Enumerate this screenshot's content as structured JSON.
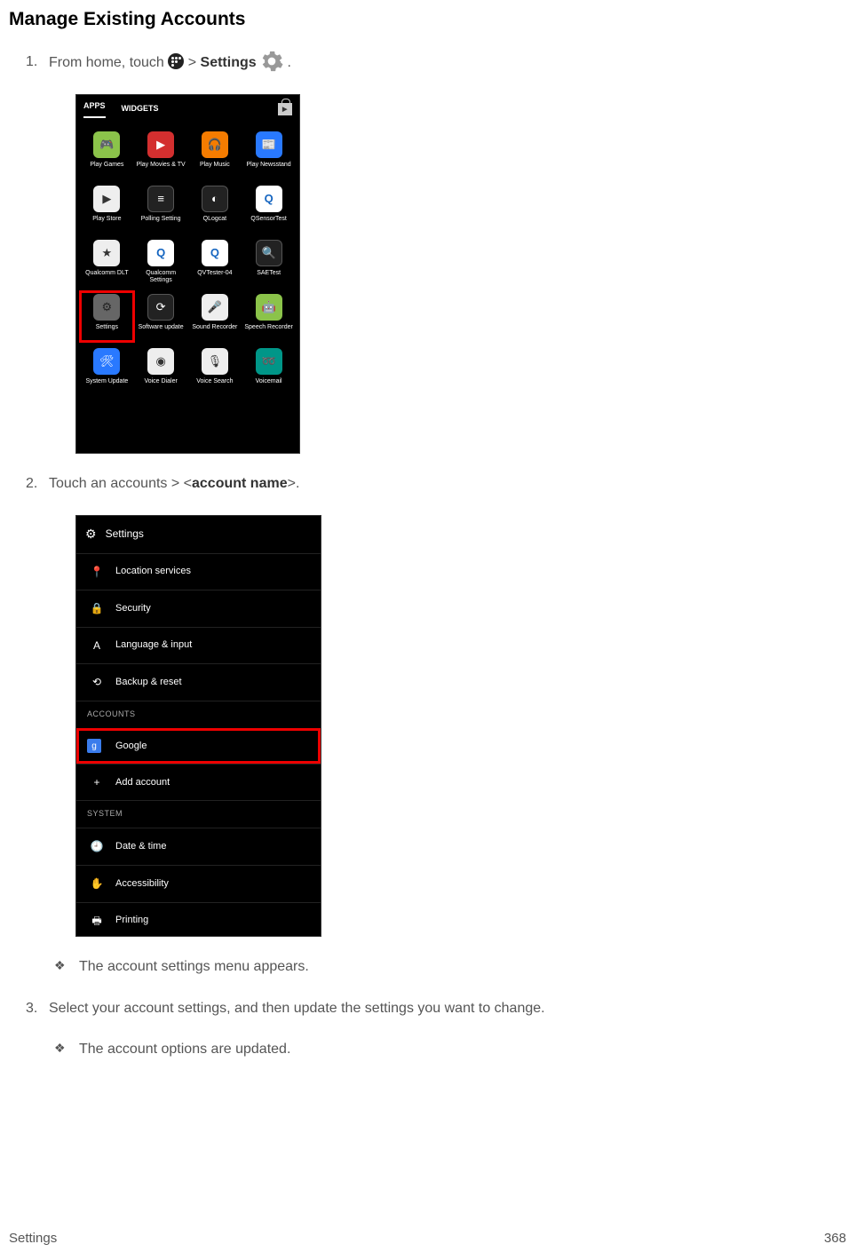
{
  "title": "Manage Existing Accounts",
  "steps": {
    "s1_pre": "From home, touch ",
    "s1_mid": " > ",
    "s1_bold": "Settings",
    "s1_post": " .",
    "s2_pre": "Touch an accounts > <",
    "s2_bold": "account name",
    "s2_post": ">.",
    "s3": "Select your account settings, and then update the settings you want to change."
  },
  "bullets": {
    "b1": "The account settings menu appears.",
    "b2": "The account options are updated."
  },
  "phone1": {
    "tabs": {
      "apps": "APPS",
      "widgets": "WIDGETS"
    },
    "apps": [
      {
        "name": "Play Games",
        "glyph": "🎮",
        "cls": "i-green"
      },
      {
        "name": "Play Movies & TV",
        "glyph": "▶",
        "cls": "i-red"
      },
      {
        "name": "Play Music",
        "glyph": "🎧",
        "cls": "i-orange"
      },
      {
        "name": "Play Newsstand",
        "glyph": "📰",
        "cls": "i-blue"
      },
      {
        "name": "Play Store",
        "glyph": "▶",
        "cls": "i-white"
      },
      {
        "name": "Polling Setting",
        "glyph": "≡",
        "cls": "i-dark"
      },
      {
        "name": "QLogcat",
        "glyph": "◐",
        "cls": "i-dark"
      },
      {
        "name": "QSensorTest",
        "glyph": "Q",
        "cls": "i-q"
      },
      {
        "name": "Qualcomm DLT",
        "glyph": "★",
        "cls": "i-white"
      },
      {
        "name": "Qualcomm Settings",
        "glyph": "Q",
        "cls": "i-q"
      },
      {
        "name": "QVTester-04",
        "glyph": "Q",
        "cls": "i-q"
      },
      {
        "name": "SAETest",
        "glyph": "🔍",
        "cls": "i-dark"
      },
      {
        "name": "Settings",
        "glyph": "⚙",
        "cls": "i-gear"
      },
      {
        "name": "Software update",
        "glyph": "⟳",
        "cls": "i-dark"
      },
      {
        "name": "Sound Recorder",
        "glyph": "🎤",
        "cls": "i-white"
      },
      {
        "name": "Speech Recorder",
        "glyph": "🤖",
        "cls": "i-green"
      },
      {
        "name": "System Update",
        "glyph": "🛠",
        "cls": "i-blue"
      },
      {
        "name": "Voice Dialer",
        "glyph": "◉",
        "cls": "i-white"
      },
      {
        "name": "Voice Search",
        "glyph": "🎙",
        "cls": "i-white"
      },
      {
        "name": "Voicemail",
        "glyph": "➿",
        "cls": "i-teal"
      }
    ],
    "highlight_index": 12
  },
  "phone2": {
    "header": "Settings",
    "rows": [
      {
        "label": "Location services",
        "icon": "📍"
      },
      {
        "label": "Security",
        "icon": "🔒"
      },
      {
        "label": "Language & input",
        "icon": "A"
      },
      {
        "label": "Backup & reset",
        "icon": "⟲"
      }
    ],
    "section1": "ACCOUNTS",
    "accounts": [
      {
        "label": "Google",
        "highlight": true
      },
      {
        "label": "Add account",
        "icon": "+"
      }
    ],
    "section2": "SYSTEM",
    "system": [
      {
        "label": "Date & time",
        "icon": "🕘"
      },
      {
        "label": "Accessibility",
        "icon": "✋"
      },
      {
        "label": "Printing",
        "icon": "🖶"
      }
    ]
  },
  "footer": {
    "left": "Settings",
    "right": "368"
  }
}
